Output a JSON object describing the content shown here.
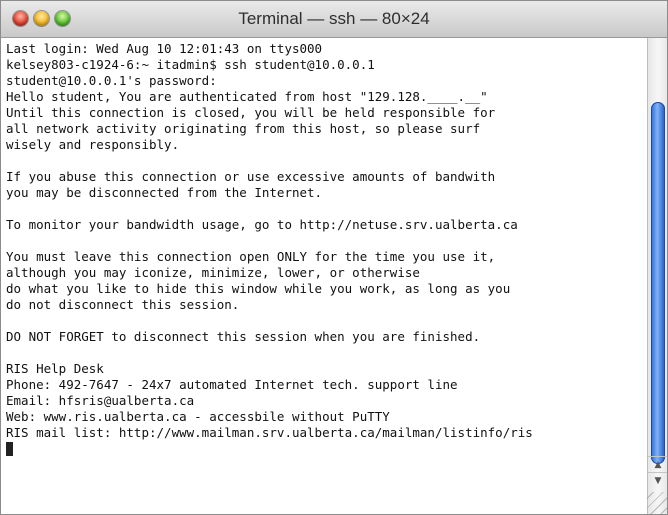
{
  "window": {
    "title": "Terminal — ssh — 80×24"
  },
  "terminal": {
    "lines": [
      "Last login: Wed Aug 10 12:01:43 on ttys000",
      "kelsey803-c1924-6:~ itadmin$ ssh student@10.0.0.1",
      "student@10.0.0.1's password:",
      "Hello student, You are authenticated from host \"129.128.____.__\"",
      "Until this connection is closed, you will be held responsible for",
      "all network activity originating from this host, so please surf",
      "wisely and responsibly.",
      "",
      "If you abuse this connection or use excessive amounts of bandwith",
      "you may be disconnected from the Internet.",
      "",
      "To monitor your bandwidth usage, go to http://netuse.srv.ualberta.ca",
      "",
      "You must leave this connection open ONLY for the time you use it,",
      "although you may iconize, minimize, lower, or otherwise",
      "do what you like to hide this window while you work, as long as you",
      "do not disconnect this session.",
      "",
      "DO NOT FORGET to disconnect this session when you are finished.",
      "",
      "RIS Help Desk",
      "Phone: 492-7647 - 24x7 automated Internet tech. support line",
      "Email: hfsris@ualberta.ca",
      "Web: www.ris.ualberta.ca - accessbile without PuTTY",
      "RIS mail list: http://www.mailman.srv.ualberta.ca/mailman/listinfo/ris"
    ]
  },
  "icons": {
    "close": "close-button-icon",
    "minimize": "minimize-button-icon",
    "zoom": "zoom-button-icon",
    "scroll_up": "▲",
    "scroll_down": "▼"
  }
}
